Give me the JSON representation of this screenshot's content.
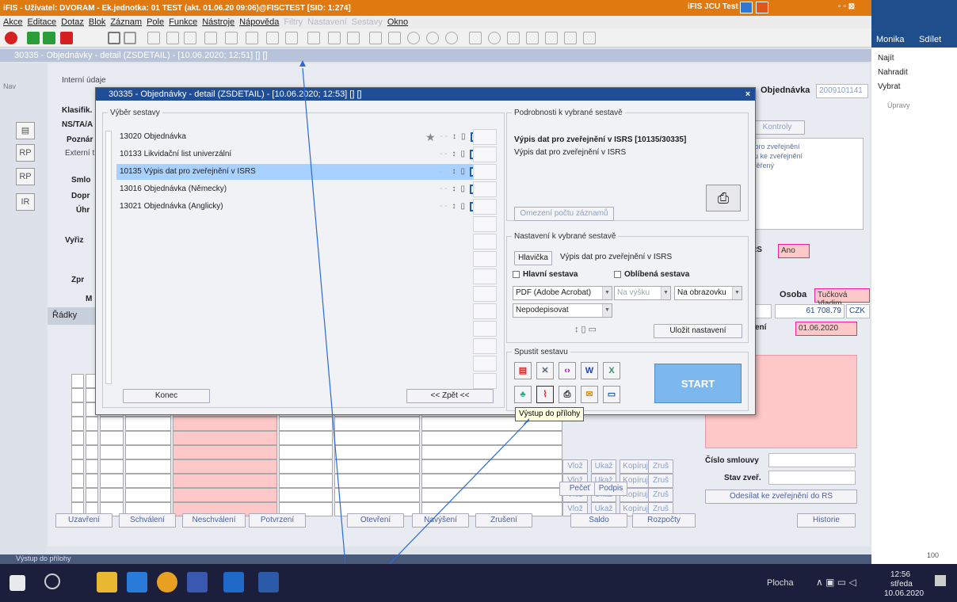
{
  "window": {
    "title": "iFIS - Uživatel: DVORAM - Ek.jednotka: 01 TEST (akt. 01.06.20 09:06)@FISCTEST  [SID: 1:274]",
    "right_label": "iFIS JCU Test"
  },
  "menu": {
    "items": [
      "Akce",
      "Editace",
      "Dotaz",
      "Blok",
      "Záznam",
      "Pole",
      "Funkce",
      "Nástroje",
      "Nápověda"
    ],
    "disabled": [
      "Filtry",
      "Nastavení",
      "Sestavy"
    ],
    "last": "Okno"
  },
  "doc_title": "30335 - Objednávky - detail (ZSDETAIL) - [10.06.2020; 12:51] [] []",
  "left": {
    "nav": "Nav",
    "icons": [
      "RP",
      "RP",
      "IR"
    ],
    "section_internal": "Interní údaje",
    "labels": [
      "Klasifik.",
      "NS/TA/A",
      "Poznár",
      "Externí t",
      "Smlo",
      "Dopr",
      "Úhr",
      "Vyřiz",
      "Zpr",
      "M"
    ],
    "tab_radky": "Řádky"
  },
  "right_form": {
    "objednavka_label": "Objednávka",
    "objednavka_value": "2009101141",
    "kontroly_tab": "Kontroly",
    "notes": [
      "a pro zveřejnění",
      "ihu ke zveřejnění",
      "ověřený"
    ],
    "irs_label": "RS",
    "irs_value": "Ano",
    "osoba_label": "Osoba",
    "osoba_value": "Tučková Vladim",
    "h_label": "H",
    "amount": "61 708.79",
    "currency": "CZK",
    "zeni_label": "zení",
    "date": "01.06.2020",
    "cislo_smlouvy": "Číslo smlouvy",
    "stav_zver": "Stav zveř.",
    "odeslat": "Odesílat ke zveřejnění do RS"
  },
  "grid_buttons": [
    "Vlož",
    "Ukaž",
    "Kopíruj",
    "Zruš"
  ],
  "pecet": "Pečeť",
  "podpis": "Podpis",
  "bottom_buttons": [
    "Uzavření",
    "Schválení",
    "Neschválení",
    "Potvrzení",
    "Otevření",
    "Navýšení",
    "Zrušení",
    "Saldo",
    "Rozpočty",
    "Historie"
  ],
  "dialog": {
    "title": "30335 - Objednávky - detail (ZSDETAIL) - [10.06.2020; 12:53] [] []",
    "select_legend": "Výběr sestavy",
    "reports": [
      {
        "code": "13020",
        "name": "Objednávka",
        "fav": true
      },
      {
        "code": "10133",
        "name": "Likvidační list univerzální",
        "fav": false
      },
      {
        "code": "10135",
        "name": "Výpis dat pro zveřejnění v ISRS",
        "fav": false
      },
      {
        "code": "13016",
        "name": "Objednávka (Německy)",
        "fav": false
      },
      {
        "code": "13021",
        "name": "Objednávka (Anglicky)",
        "fav": false
      }
    ],
    "konec": "Konec",
    "zpet": "<< Zpět <<",
    "details_legend": "Podrobnosti k vybrané sestavě",
    "details_title": "Výpis dat pro zveřejnění v ISRS [10135/30335]",
    "details_sub": "Výpis dat pro zveřejnění v ISRS",
    "omezeni": "Omezení počtu záznamů",
    "settings_legend": "Nastavení k vybrané sestavě",
    "hlavicka": "Hlavička",
    "hlavicka_text": "Výpis dat pro zveřejnění v ISRS",
    "hlavni": "Hlavní sestava",
    "oblibena": "Oblíbená sestava",
    "format": "PDF (Adobe Acrobat)",
    "na_vysku": "Na výšku",
    "na_obrazovku": "Na obrazovku",
    "nepodepisovat": "Nepodepisovat",
    "ulozit": "Uložit nastavení",
    "run_legend": "Spustit sestavu",
    "start": "START",
    "tooltip": "Výstup do přílohy"
  },
  "office": {
    "user": "Monika",
    "share": "Sdílet",
    "najit": "Najít",
    "nahradit": "Nahradit",
    "vybrat": "Vybrat",
    "upravy": "Úpravy",
    "zoom": "100"
  },
  "statusbar": "Výstup do přílohy",
  "taskbar": {
    "plocha": "Plocha",
    "time": "12:56",
    "day": "středa",
    "date": "10.06.2020"
  }
}
